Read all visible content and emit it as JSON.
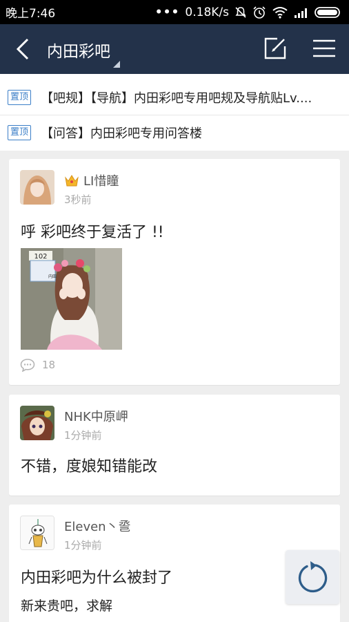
{
  "status_bar": {
    "time": "晚上7:46",
    "network_speed": "0.18K/s",
    "icons": [
      "signal-dots-icon",
      "mute-icon",
      "alarm-icon",
      "wifi-icon",
      "cell-signal-icon",
      "battery-icon"
    ]
  },
  "nav": {
    "title": "内田彩吧",
    "icons": [
      "back-arrow-icon",
      "edit-icon",
      "menu-icon"
    ]
  },
  "pinned": [
    {
      "badge": "置顶",
      "text": "【吧规】【导航】内田彩吧专用吧规及导航贴Lv...."
    },
    {
      "badge": "置顶",
      "text": "【问答】内田彩吧专用问答楼"
    }
  ],
  "posts": [
    {
      "username": "LI惜瞳",
      "time": "3秒前",
      "title": "呼 彩吧终于复活了 !!",
      "comment_count": "18",
      "photo_label": "102",
      "photo_sign": "内田 彩"
    },
    {
      "username": "NHK中原岬",
      "time": "1分钟前",
      "title": "不错，度娘知错能改"
    },
    {
      "username": "Eleven丶巹",
      "time": "1分钟前",
      "title": "内田彩吧为什么被封了",
      "subtitle": "新来贵吧，求解"
    }
  ],
  "colors": {
    "nav_bg": "#23324a",
    "pin_badge": "#3a7ec7",
    "page_bg": "#eeeeee"
  }
}
